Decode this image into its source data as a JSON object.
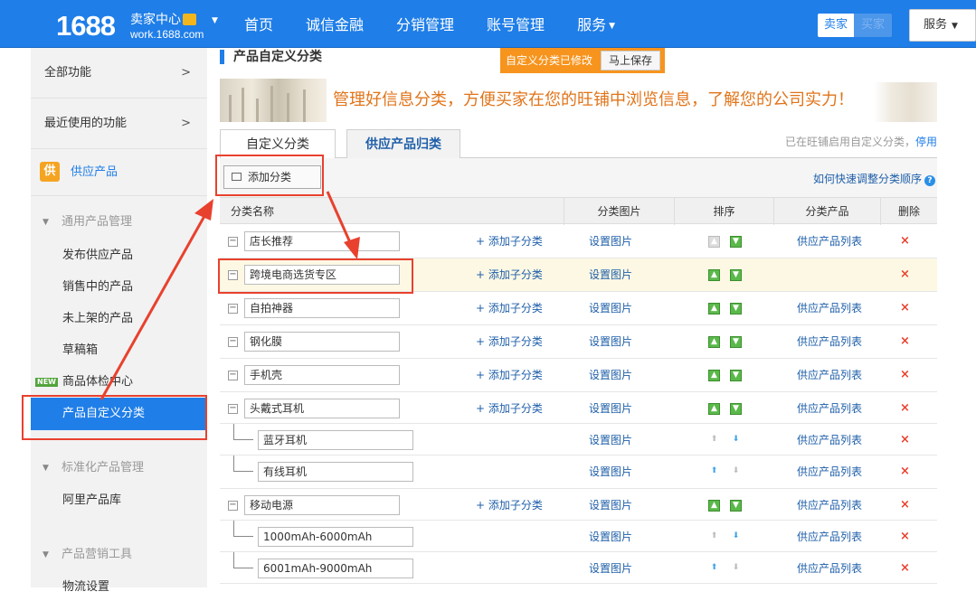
{
  "header": {
    "logo": "1688",
    "seller_center": "卖家中心",
    "site_url": "work.1688.com",
    "nav": [
      "首页",
      "诚信金融",
      "分销管理",
      "账号管理",
      "服务"
    ],
    "switch_seller": "卖家",
    "switch_buyer": "买家",
    "service_btn": "服务"
  },
  "sidebar": {
    "all_functions": "全部功能",
    "recent_functions": "最近使用的功能",
    "supply_products": "供应产品",
    "supply_icon_char": "供",
    "group_general": "通用产品管理",
    "general_items": [
      "发布供应产品",
      "销售中的产品",
      "未上架的产品",
      "草稿箱",
      "商品体检中心",
      "产品自定义分类"
    ],
    "new_badge": "NEW",
    "group_standard": "标准化产品管理",
    "standard_items": [
      "阿里产品库"
    ],
    "group_marketing": "产品营销工具",
    "marketing_items": [
      "物流设置"
    ]
  },
  "main": {
    "title": "产品自定义分类",
    "notice_text": "自定义分类已修改",
    "save_now": "马上保存",
    "banner_text": "管理好信息分类，方便买家在您的旺铺中浏览信息，了解您的公司实力！",
    "tab_custom": "自定义分类",
    "tab_supply": "供应产品归类",
    "enabled_text": "已在旺铺启用自定义分类，",
    "disable_link": "停用",
    "add_category": "添加分类",
    "help_text": "如何快速调整分类顺序",
    "columns": [
      "分类名称",
      "分类图片",
      "排序",
      "分类产品",
      "删除"
    ],
    "add_sub": "+ 添加子分类",
    "set_image": "设置图片",
    "product_list": "供应产品列表",
    "delete_mark": "×",
    "rows": [
      {
        "name": "店长推荐",
        "level": 1,
        "has_products": true,
        "highlight": false
      },
      {
        "name": "跨境电商选货专区",
        "level": 1,
        "has_products": false,
        "highlight": true
      },
      {
        "name": "自拍神器",
        "level": 1,
        "has_products": true,
        "highlight": false
      },
      {
        "name": "钢化膜",
        "level": 1,
        "has_products": true,
        "highlight": false
      },
      {
        "name": "手机壳",
        "level": 1,
        "has_products": true,
        "highlight": false
      },
      {
        "name": "头戴式耳机",
        "level": 1,
        "has_products": true,
        "highlight": false
      },
      {
        "name": "蓝牙耳机",
        "level": 2,
        "has_products": true,
        "highlight": false
      },
      {
        "name": "有线耳机",
        "level": 2,
        "has_products": true,
        "highlight": false
      },
      {
        "name": "移动电源",
        "level": 1,
        "has_products": true,
        "highlight": false
      },
      {
        "name": "1000mAh-6000mAh",
        "level": 2,
        "has_products": true,
        "highlight": false
      },
      {
        "name": "6001mAh-9000mAh",
        "level": 2,
        "has_products": true,
        "highlight": false
      }
    ]
  },
  "colors": {
    "brand_blue": "#1f7ee8",
    "annotation_red": "#e8412e",
    "notice_orange": "#f7941d"
  }
}
